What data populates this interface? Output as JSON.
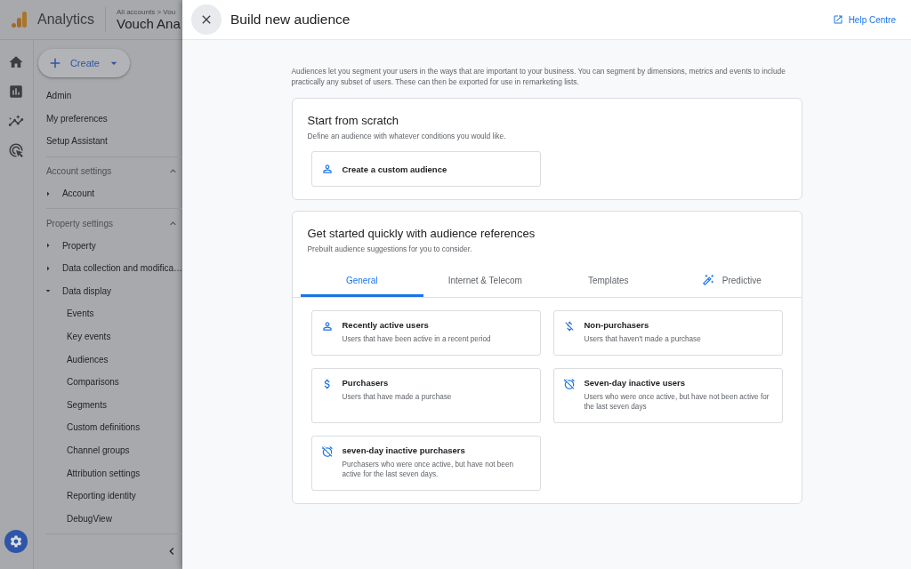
{
  "app": {
    "product": "Analytics",
    "breadcrumb": "All accounts > Vou",
    "property": "Vouch Ana",
    "create_button": "Create",
    "nav_top": [
      "Admin",
      "My preferences",
      "Setup Assistant"
    ],
    "sections": [
      {
        "title": "Account settings",
        "expanded": true,
        "items": [
          {
            "label": "Account",
            "expanded": false
          }
        ]
      },
      {
        "title": "Property settings",
        "expanded": true,
        "items": [
          {
            "label": "Property",
            "expanded": false
          },
          {
            "label": "Data collection and modifica…",
            "expanded": false
          },
          {
            "label": "Data display",
            "expanded": true,
            "children": [
              "Events",
              "Key events",
              "Audiences",
              "Comparisons",
              "Segments",
              "Custom definitions",
              "Channel groups",
              "Attribution settings",
              "Reporting identity",
              "DebugView"
            ]
          }
        ]
      }
    ]
  },
  "panel": {
    "title": "Build new audience",
    "help_link": "Help Centre",
    "intro": "Audiences let you segment your users in the ways that are important to your business. You can segment by dimensions, metrics and events to include practically any subset of users. These can then be exported for use in remarketing lists.",
    "scratch": {
      "title": "Start from scratch",
      "subtitle": "Define an audience with whatever conditions you would like.",
      "option": {
        "kind": "person",
        "title": "Create a custom audience"
      }
    },
    "references": {
      "title": "Get started quickly with audience references",
      "subtitle": "Prebuilt audience suggestions for you to consider.",
      "tabs": [
        {
          "label": "General",
          "selected": true
        },
        {
          "label": "Internet & Telecom",
          "selected": false
        },
        {
          "label": "Templates",
          "selected": false
        },
        {
          "label": "Predictive",
          "selected": false,
          "kind": "wand"
        }
      ],
      "cards": [
        {
          "kind": "person",
          "title": "Recently active users",
          "description": "Users that have been active in a recent period"
        },
        {
          "kind": "no-money",
          "title": "Non-purchasers",
          "description": "Users that haven't made a purchase"
        },
        {
          "kind": "money",
          "title": "Purchasers",
          "description": "Users that have made a purchase"
        },
        {
          "kind": "alarm-off",
          "title": "Seven-day inactive users",
          "description": "Users who were once active, but have not been active for the last seven days"
        },
        {
          "kind": "alarm-off",
          "title": "seven-day inactive purchasers",
          "description": "Purchasers who were once active, but have not been active for the last seven days."
        }
      ]
    }
  }
}
